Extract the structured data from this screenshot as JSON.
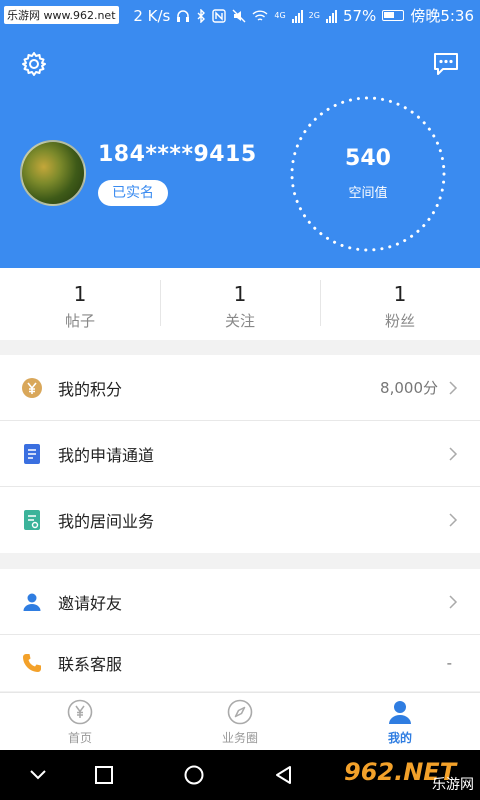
{
  "status_bar": {
    "watermark": "乐游网 www.962.net",
    "speed": "2 K/s",
    "network_labels": [
      "4G",
      "2G"
    ],
    "battery": "57%",
    "time": "傍晚5:36"
  },
  "profile": {
    "phone": "184****9415",
    "verified_badge": "已实名",
    "score_value": "540",
    "score_label": "空间值"
  },
  "stats": [
    {
      "num": "1",
      "label": "帖子"
    },
    {
      "num": "1",
      "label": "关注"
    },
    {
      "num": "1",
      "label": "粉丝"
    }
  ],
  "menu_group_1": [
    {
      "icon": "yen-coin-icon",
      "label": "我的积分",
      "value": "8,000分"
    },
    {
      "icon": "document-icon",
      "label": "我的申请通道",
      "value": ""
    },
    {
      "icon": "business-doc-icon",
      "label": "我的居间业务",
      "value": ""
    }
  ],
  "menu_group_2": [
    {
      "icon": "person-icon",
      "label": "邀请好友",
      "value": ""
    },
    {
      "icon": "phone-icon",
      "label": "联系客服",
      "value": "-"
    }
  ],
  "bottom_nav": [
    {
      "icon": "yen-circle-icon",
      "label": "首页",
      "active": false
    },
    {
      "icon": "compass-icon",
      "label": "业务圈",
      "active": false
    },
    {
      "icon": "person-icon",
      "label": "我的",
      "active": true
    }
  ],
  "site_watermark": {
    "big": "962.NET",
    "small": "乐游网"
  },
  "colors": {
    "primary": "#3a8bf0",
    "active_tab": "#2f7de1",
    "coin": "#d9a75a",
    "doc_blue": "#3a6fe0",
    "doc_green": "#3bb39a",
    "phone_orange": "#f3a12a"
  }
}
